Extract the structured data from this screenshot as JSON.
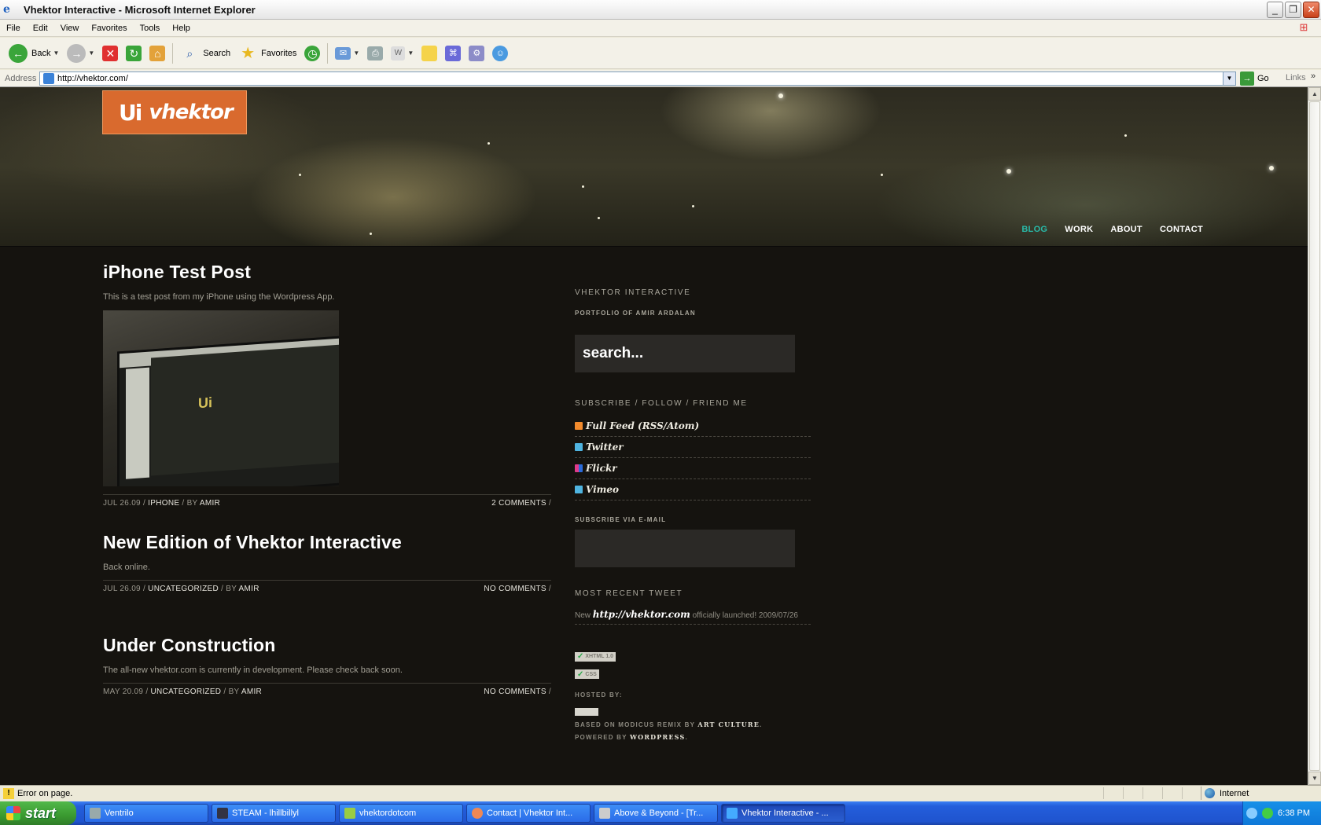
{
  "window": {
    "title": "Vhektor Interactive - Microsoft Internet Explorer"
  },
  "menu": [
    "File",
    "Edit",
    "View",
    "Favorites",
    "Tools",
    "Help"
  ],
  "toolbar": {
    "back": "Back",
    "search": "Search",
    "favorites": "Favorites"
  },
  "address": {
    "label": "Address",
    "url": "http://vhektor.com/",
    "go": "Go",
    "links": "Links"
  },
  "site": {
    "logo_mark": "Ui",
    "logo_text": "vhektor",
    "nav": [
      {
        "label": "BLOG",
        "active": true
      },
      {
        "label": "WORK",
        "active": false
      },
      {
        "label": "ABOUT",
        "active": false
      },
      {
        "label": "CONTACT",
        "active": false
      }
    ]
  },
  "posts": [
    {
      "title": "iPhone Test Post",
      "excerpt": "This is a test post from my iPhone using the Wordpress App.",
      "has_image": true,
      "date": "JUL 26.09",
      "category": "IPHONE",
      "by": "BY",
      "author": "AMIR",
      "comments": "2 COMMENTS"
    },
    {
      "title": "New Edition of Vhektor Interactive",
      "excerpt": "Back online.",
      "has_image": false,
      "date": "JUL 26.09",
      "category": "UNCATEGORIZED",
      "by": "BY",
      "author": "AMIR",
      "comments": "NO COMMENTS"
    },
    {
      "title": "Under Construction",
      "excerpt": "The all-new vhektor.com is currently in development. Please check back soon.",
      "has_image": false,
      "date": "MAY 20.09",
      "category": "UNCATEGORIZED",
      "by": "BY",
      "author": "AMIR",
      "comments": "NO COMMENTS"
    }
  ],
  "sidebar": {
    "heading": "VHEKTOR INTERACTIVE",
    "subheading": "PORTFOLIO OF AMIR ARDALAN",
    "search_placeholder": "search...",
    "subscribe_heading": "SUBSCRIBE / FOLLOW / FRIEND ME",
    "social": [
      {
        "label": "Full Feed (RSS/Atom)",
        "icon": "rss-icon",
        "color": "#f28a2c"
      },
      {
        "label": "Twitter",
        "icon": "twitter-icon",
        "color": "#4fb4e0"
      },
      {
        "label": "Flickr",
        "icon": "flickr-icon",
        "color": "#e03a8a"
      },
      {
        "label": "Vimeo",
        "icon": "vimeo-icon",
        "color": "#4fb4e0"
      }
    ],
    "email_heading": "SUBSCRIBE VIA E-MAIL",
    "tweet_heading": "MOST RECENT TWEET",
    "tweet_prefix": "New",
    "tweet_link": "http://vhektor.com",
    "tweet_suffix": "officially launched! 2009/07/26",
    "badge_xhtml": "XHTML 1.0",
    "badge_css": "CSS",
    "hosted_by": "HOSTED BY:",
    "credit_prefix": "BASED ON MODICUS REMIX BY",
    "credit_name": "ART CULTURE",
    "powered_prefix": "POWERED BY",
    "powered_name": "WORDPRESS"
  },
  "status": {
    "text": "Error on page.",
    "zone": "Internet"
  },
  "taskbar": {
    "start": "start",
    "tasks": [
      {
        "label": "Ventrilo",
        "color": "#9aa",
        "active": false
      },
      {
        "label": "STEAM - lhillbillyl",
        "color": "#334",
        "active": false
      },
      {
        "label": "vhektordotcom",
        "color": "#9c4",
        "active": false
      },
      {
        "label": "Contact | Vhektor Int...",
        "color": "#e85",
        "active": false
      },
      {
        "label": "Above & Beyond - [Tr...",
        "color": "#ccc",
        "active": false
      },
      {
        "label": "Vhektor Interactive - ...",
        "color": "#4af",
        "active": true
      }
    ],
    "clock": "6:38 PM"
  }
}
